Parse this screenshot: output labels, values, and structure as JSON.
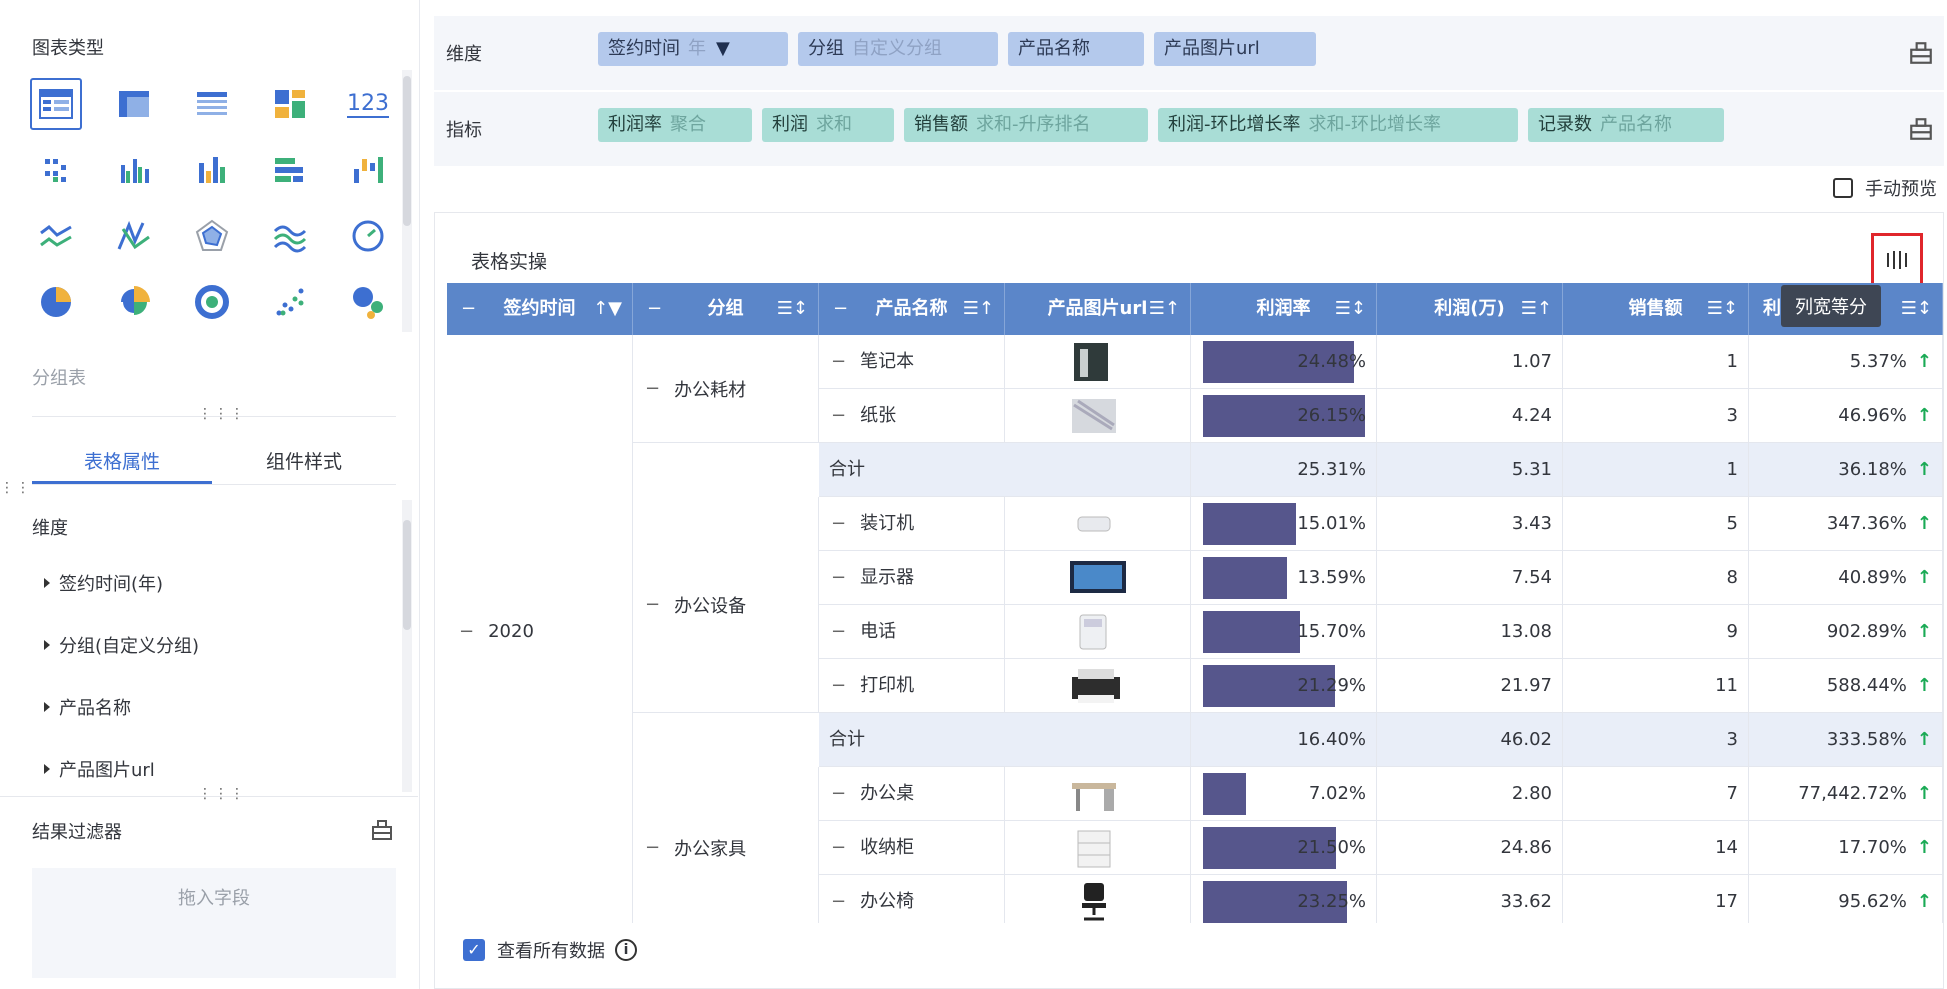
{
  "left": {
    "chart_types_title": "图表类型",
    "kpi_label": "123",
    "group_table_label": "分组表",
    "tabs": [
      "表格属性",
      "组件样式"
    ],
    "dimension_label": "维度",
    "dimension_items": [
      "签约时间(年)",
      "分组(自定义分组)",
      "产品名称",
      "产品图片url"
    ],
    "result_filter_title": "结果过滤器",
    "drop_placeholder": "拖入字段"
  },
  "fields": {
    "dimension_label": "维度",
    "dimension_chips": [
      {
        "name": "签约时间",
        "sub": "年"
      },
      {
        "name": "分组",
        "sub": "自定义分组"
      },
      {
        "name": "产品名称",
        "sub": ""
      },
      {
        "name": "产品图片url",
        "sub": ""
      }
    ],
    "metric_label": "指标",
    "metric_chips": [
      {
        "name": "利润率",
        "sub": "聚合"
      },
      {
        "name": "利润",
        "sub": "求和"
      },
      {
        "name": "销售额",
        "sub": "求和-升序排名"
      },
      {
        "name": "利润-环比增长率",
        "sub": "求和-环比增长率"
      },
      {
        "name": "记录数",
        "sub": "产品名称"
      }
    ]
  },
  "manual_preview": "手动预览",
  "card": {
    "title": "表格实操",
    "tooltip": "列宽等分",
    "view_all": "查看所有数据",
    "info_icon": "i"
  },
  "table": {
    "headers": [
      "签约时间",
      "分组",
      "产品名称",
      "产品图片url",
      "利润率",
      "利润(万)",
      "销售额",
      "利"
    ],
    "year": "2020",
    "groups": [
      {
        "name": "办公耗材",
        "rows": [
          {
            "product": "笔记本",
            "rate": "24.48%",
            "rate_pct": 24.48,
            "profit": "1.07",
            "sales": "1",
            "growth": "5.37%"
          },
          {
            "product": "纸张",
            "rate": "26.15%",
            "rate_pct": 26.15,
            "profit": "4.24",
            "sales": "3",
            "growth": "46.96%"
          }
        ],
        "subtotal": {
          "label": "合计",
          "rate": "25.31%",
          "profit": "5.31",
          "sales": "1",
          "growth": "36.18%"
        }
      },
      {
        "name": "办公设备",
        "rows": [
          {
            "product": "装订机",
            "rate": "15.01%",
            "rate_pct": 15.01,
            "profit": "3.43",
            "sales": "5",
            "growth": "347.36%"
          },
          {
            "product": "显示器",
            "rate": "13.59%",
            "rate_pct": 13.59,
            "profit": "7.54",
            "sales": "8",
            "growth": "40.89%"
          },
          {
            "product": "电话",
            "rate": "15.70%",
            "rate_pct": 15.7,
            "profit": "13.08",
            "sales": "9",
            "growth": "902.89%"
          },
          {
            "product": "打印机",
            "rate": "21.29%",
            "rate_pct": 21.29,
            "profit": "21.97",
            "sales": "11",
            "growth": "588.44%"
          }
        ],
        "subtotal": {
          "label": "合计",
          "rate": "16.40%",
          "profit": "46.02",
          "sales": "3",
          "growth": "333.58%"
        }
      },
      {
        "name": "办公家具",
        "rows": [
          {
            "product": "办公桌",
            "rate": "7.02%",
            "rate_pct": 7.02,
            "profit": "2.80",
            "sales": "7",
            "growth": "77,442.72%"
          },
          {
            "product": "收纳柜",
            "rate": "21.50%",
            "rate_pct": 21.5,
            "profit": "24.86",
            "sales": "14",
            "growth": "17.70%"
          },
          {
            "product": "办公椅",
            "rate": "23.25%",
            "rate_pct": 23.25,
            "profit": "33.62",
            "sales": "17",
            "growth": "95.62%"
          }
        ]
      }
    ]
  },
  "colors": {
    "accent": "#3d6fd1",
    "header": "#5b86c9",
    "bar": "#56568c",
    "up": "#1aaa55",
    "highlight": "#e0262b"
  }
}
